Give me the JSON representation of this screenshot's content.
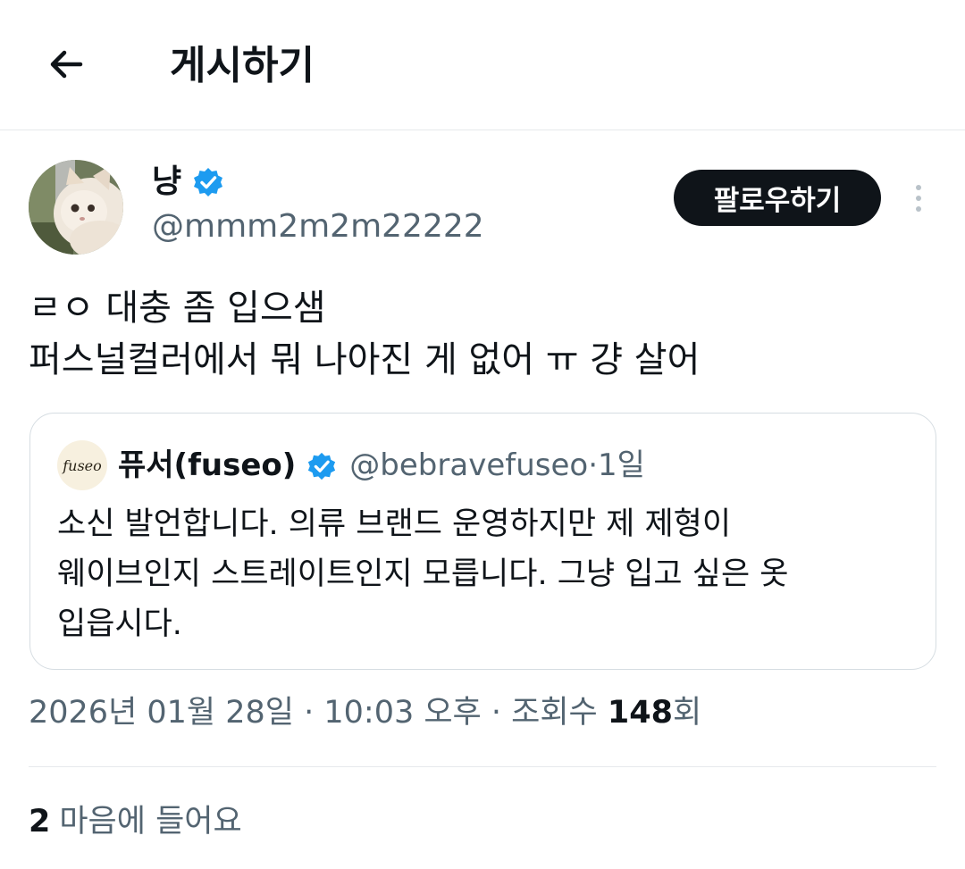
{
  "header": {
    "title": "게시하기",
    "back_icon": "arrow-left-icon"
  },
  "author": {
    "display_name": "냥",
    "handle": "@mmm2m2m22222",
    "verified": true,
    "avatar": "cat-avatar"
  },
  "follow_button": {
    "label": "팔로우하기"
  },
  "more_icon": "more-vertical-icon",
  "tweet": {
    "text": "ㄹㅇ 대충 좀 입으샘\n퍼스널컬러에서 뭐 나아진 게 없어 ㅠ 걍 살어"
  },
  "quote": {
    "avatar_text": "fuseo",
    "display_name": "퓨서(fuseo)",
    "verified": true,
    "handle": "@bebravefuseo",
    "separator": " · ",
    "time": "1일",
    "text": "소신 발언합니다. 의류 브랜드 운영하지만 제 제형이\n웨이브인지 스트레이트인지 모릅니다. 그냥 입고 싶은 옷\n입읍시다."
  },
  "meta": {
    "timestamp": "2026년 01월 28일 · 10:03 오후 · 조회수 ",
    "views_count": "148",
    "views_suffix": "회"
  },
  "likes": {
    "count": "2",
    "label": "마음에 들어요"
  },
  "colors": {
    "verified_blue": "#1d9bf0",
    "text_primary": "#0f1419",
    "text_secondary": "#536471",
    "follow_bg": "#0f1419"
  }
}
